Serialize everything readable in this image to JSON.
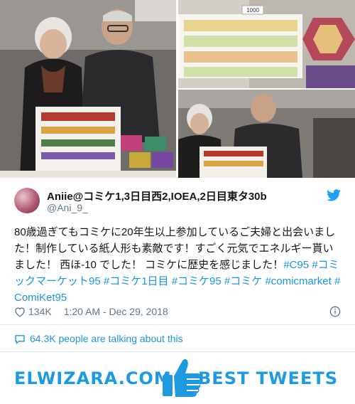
{
  "photos": {
    "main_alt": "elderly-couple-photo",
    "top_right_alt": "paper-dolls-display-photo",
    "bottom_right_alt": "couple-at-booth-photo",
    "sign_text": "1000"
  },
  "user": {
    "display_name": "Aniie@コミケ1,3日目西2,IOEA,2日目東タ30b",
    "handle": "@Ani_9_"
  },
  "tweet": {
    "text_parts": [
      {
        "type": "text",
        "value": "80歳過ぎてもコミケに20年生以上参加しているご夫婦と出会いました！制作している紙人形も素敵です！すごく元気でエネルギー貰いました！ 西ほ-10 でした！ コミケに歴史を感じました！"
      },
      {
        "type": "hashtag",
        "value": "#C95"
      },
      {
        "type": "text",
        "value": " "
      },
      {
        "type": "hashtag",
        "value": "#コミックマーケット95"
      },
      {
        "type": "text",
        "value": " "
      },
      {
        "type": "hashtag",
        "value": "#コミケ1日目"
      },
      {
        "type": "text",
        "value": " "
      },
      {
        "type": "hashtag",
        "value": "#コミケ95"
      },
      {
        "type": "text",
        "value": " "
      },
      {
        "type": "hashtag",
        "value": "#コミケ"
      },
      {
        "type": "text",
        "value": " "
      },
      {
        "type": "hashtag",
        "value": "#comicmarket"
      },
      {
        "type": "text",
        "value": " "
      },
      {
        "type": "hashtag",
        "value": "#ComiKet95"
      }
    ]
  },
  "meta": {
    "likes": "134K",
    "timestamp": "1:20 AM - Dec 29, 2018"
  },
  "talking": {
    "text": "64.3K people are talking about this"
  },
  "footer": {
    "brand_left": "ELWIZARA.COM",
    "brand_right": "BEST TWEETS"
  },
  "colors": {
    "accent": "#1b95e0",
    "brand": "#1e9ae0",
    "muted": "#657786"
  }
}
